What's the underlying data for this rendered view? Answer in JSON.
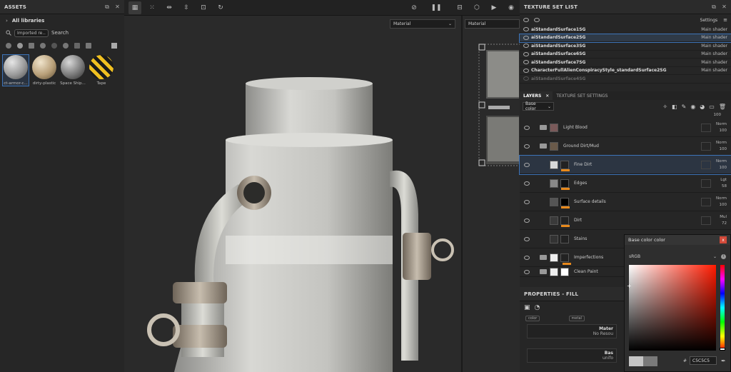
{
  "assets": {
    "title": "ASSETS",
    "libraries_label": "All libraries",
    "search_value": "Imported re...",
    "search_label": "Search",
    "items": [
      {
        "label": "ct-armor-c..."
      },
      {
        "label": "dirty-plastic"
      },
      {
        "label": "Space Ship..."
      },
      {
        "label": "Tape"
      }
    ]
  },
  "viewport": {
    "left_mode": "Material",
    "right_mode": "Material"
  },
  "texture_set_list": {
    "title": "TEXTURE SET LIST",
    "settings_label": "Settings",
    "rows": [
      {
        "name": "aiStandardSurface1SG",
        "shader": "Main shader"
      },
      {
        "name": "aiStandardSurface2SG",
        "shader": "Main shader"
      },
      {
        "name": "aiStandardSurface3SG",
        "shader": "Main shader"
      },
      {
        "name": "aiStandardSurface6SG",
        "shader": "Main shader"
      },
      {
        "name": "aiStandardSurface7SG",
        "shader": "Main shader"
      },
      {
        "name": "CharacterFullAlienConspiracyStyle_standardSurface2SG",
        "shader": "Main shader"
      },
      {
        "name": "aiStandardSurface4SG",
        "shader": ""
      }
    ]
  },
  "layers": {
    "tab_layers": "LAYERS",
    "tab_settings": "TEXTURE SET SETTINGS",
    "channel": "Base color",
    "top_value": "100",
    "rows": [
      {
        "name": "Light Blood",
        "blend": "Norm",
        "opacity": "100"
      },
      {
        "name": "Ground Dirt/Mud",
        "blend": "Norm",
        "opacity": "100"
      },
      {
        "name": "Fine Dirt",
        "blend": "Norm",
        "opacity": "100"
      },
      {
        "name": "Edges",
        "blend": "Lgt",
        "opacity": "58"
      },
      {
        "name": "Surface details",
        "blend": "Norm",
        "opacity": "100"
      },
      {
        "name": "Dirt",
        "blend": "Mul",
        "opacity": "72"
      },
      {
        "name": "Stains",
        "blend": "",
        "opacity": ""
      },
      {
        "name": "Imperfections",
        "blend": "",
        "opacity": ""
      },
      {
        "name": "Clean Paint",
        "blend": "",
        "opacity": ""
      }
    ]
  },
  "properties": {
    "title": "PROPERTIES - FILL",
    "btn_color": "color",
    "btn_metal": "metal",
    "material_label": "Mater",
    "material_value": "No Resou",
    "base_label": "Bas",
    "base_value": "unifo"
  },
  "color_picker": {
    "title": "Base color color",
    "color_space": "sRGB",
    "hex_label": "#",
    "hex_value": "C5C5C5",
    "close_label": "x",
    "accent": "#e8891c"
  }
}
